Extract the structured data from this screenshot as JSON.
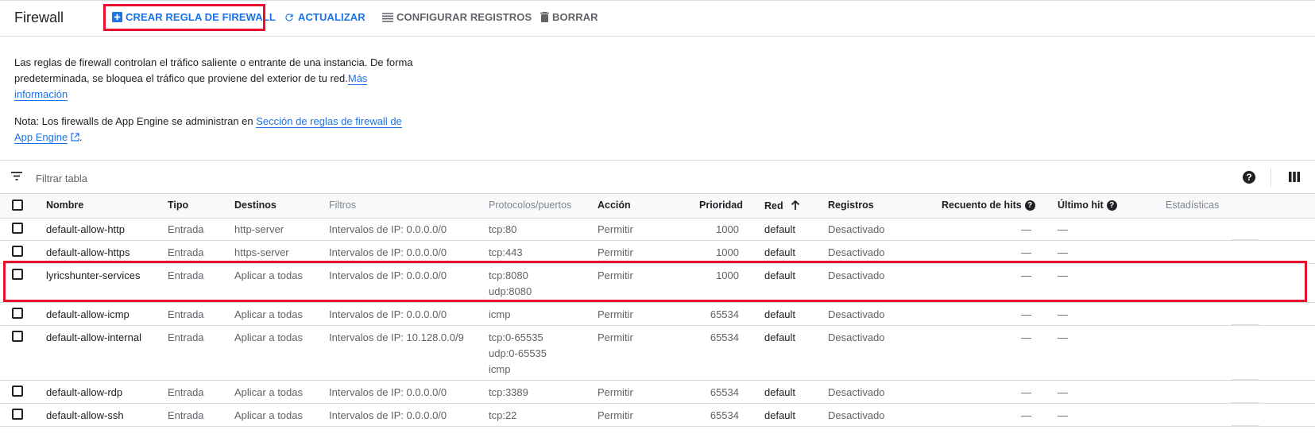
{
  "header": {
    "title": "Firewall",
    "actions": {
      "create": "CREAR REGLA DE FIREWALL",
      "refresh": "ACTUALIZAR",
      "logs": "CONFIGURAR REGISTROS",
      "delete": "BORRAR"
    }
  },
  "intro": {
    "p1_text": "Las reglas de firewall controlan el tráfico saliente o entrante de una instancia. De forma predeterminada, se bloquea el tráfico que proviene del exterior de tu red.",
    "p1_link": "Más información",
    "p2_text": "Nota: Los firewalls de App Engine se administran en ",
    "p2_link": "Sección de reglas de firewall de App Engine",
    "p2_end": "."
  },
  "filter": {
    "placeholder": "Filtrar tabla",
    "help": "?"
  },
  "table": {
    "headers": {
      "name": "Nombre",
      "type": "Tipo",
      "targets": "Destinos",
      "filters": "Filtros",
      "protocols": "Protocolos/puertos",
      "action": "Acción",
      "priority": "Prioridad",
      "network": "Red",
      "logs": "Registros",
      "hits": "Recuento de hits",
      "last_hit": "Último hit",
      "stats": "Estadísticas"
    },
    "rows": [
      {
        "name": "default-allow-http",
        "type": "Entrada",
        "targets": "http-server",
        "filters": "Intervalos de IP: 0.0.0.0/0",
        "protocols": [
          "tcp:80"
        ],
        "action": "Permitir",
        "priority": "1000",
        "network": "default",
        "logs": "Desactivado",
        "hits": "—",
        "last_hit": "—"
      },
      {
        "name": "default-allow-https",
        "type": "Entrada",
        "targets": "https-server",
        "filters": "Intervalos de IP: 0.0.0.0/0",
        "protocols": [
          "tcp:443"
        ],
        "action": "Permitir",
        "priority": "1000",
        "network": "default",
        "logs": "Desactivado",
        "hits": "—",
        "last_hit": "—"
      },
      {
        "name": "lyricshunter-services",
        "type": "Entrada",
        "targets": "Aplicar a todas",
        "filters": "Intervalos de IP: 0.0.0.0/0",
        "protocols": [
          "tcp:8080",
          "udp:8080"
        ],
        "action": "Permitir",
        "priority": "1000",
        "network": "default",
        "logs": "Desactivado",
        "hits": "—",
        "last_hit": "—"
      },
      {
        "name": "default-allow-icmp",
        "type": "Entrada",
        "targets": "Aplicar a todas",
        "filters": "Intervalos de IP: 0.0.0.0/0",
        "protocols": [
          "icmp"
        ],
        "action": "Permitir",
        "priority": "65534",
        "network": "default",
        "logs": "Desactivado",
        "hits": "—",
        "last_hit": "—"
      },
      {
        "name": "default-allow-internal",
        "type": "Entrada",
        "targets": "Aplicar a todas",
        "filters": "Intervalos de IP: 10.128.0.0/9",
        "protocols": [
          "tcp:0-65535",
          "udp:0-65535",
          "icmp"
        ],
        "action": "Permitir",
        "priority": "65534",
        "network": "default",
        "logs": "Desactivado",
        "hits": "—",
        "last_hit": "—"
      },
      {
        "name": "default-allow-rdp",
        "type": "Entrada",
        "targets": "Aplicar a todas",
        "filters": "Intervalos de IP: 0.0.0.0/0",
        "protocols": [
          "tcp:3389"
        ],
        "action": "Permitir",
        "priority": "65534",
        "network": "default",
        "logs": "Desactivado",
        "hits": "—",
        "last_hit": "—"
      },
      {
        "name": "default-allow-ssh",
        "type": "Entrada",
        "targets": "Aplicar a todas",
        "filters": "Intervalos de IP: 0.0.0.0/0",
        "protocols": [
          "tcp:22"
        ],
        "action": "Permitir",
        "priority": "65534",
        "network": "default",
        "logs": "Desactivado",
        "hits": "—",
        "last_hit": "—"
      }
    ]
  },
  "colors": {
    "accent": "#1a73e8",
    "highlight": "#e8112d"
  }
}
